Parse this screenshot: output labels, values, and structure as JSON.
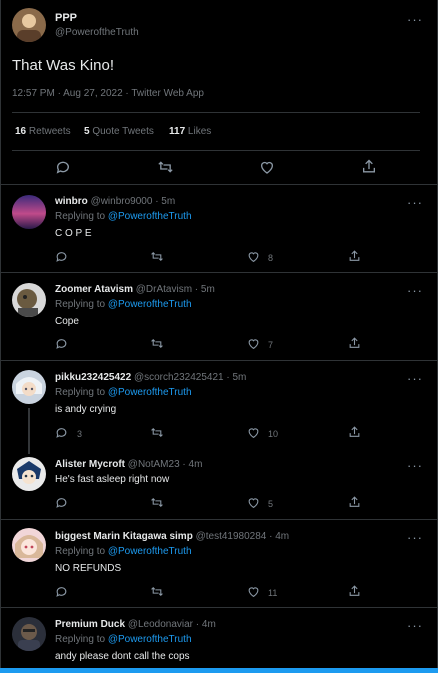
{
  "main": {
    "author_name": "PPP",
    "author_handle": "@PoweroftheTruth",
    "text": "That Was Kino!",
    "meta": "12:57 PM · Aug 27, 2022 · Twitter Web App",
    "stats": {
      "retweets_count": "16",
      "retweets_label": "Retweets",
      "quotes_count": "5",
      "quotes_label": "Quote Tweets",
      "likes_count": "117",
      "likes_label": "Likes"
    }
  },
  "more_glyph": "···",
  "replies": [
    {
      "name": "winbro",
      "handle_time": "@winbro9000 · 5m",
      "replying_prefix": "Replying to",
      "replying_to": "@PoweroftheTruth",
      "text": "C O P E",
      "reply_count": "",
      "like_count": "8"
    },
    {
      "name": "Zoomer Atavism",
      "handle_time": "@DrAtavism · 5m",
      "replying_prefix": "Replying to",
      "replying_to": "@PoweroftheTruth",
      "text": "Cope",
      "reply_count": "",
      "like_count": "7"
    },
    {
      "name": "pikku232425422",
      "handle_time": "@scorch232425421 · 5m",
      "replying_prefix": "Replying to",
      "replying_to": "@PoweroftheTruth",
      "text": "is andy crying",
      "reply_count": "3",
      "like_count": "10"
    },
    {
      "name": "Alister Mycroft",
      "handle_time": "@NotAM23 · 4m",
      "replying_prefix": "",
      "replying_to": "",
      "text": "He's fast asleep right now",
      "reply_count": "",
      "like_count": "5"
    },
    {
      "name": "biggest Marin Kitagawa simp",
      "handle_time": "@test41980284 · 4m",
      "replying_prefix": "Replying to",
      "replying_to": "@PoweroftheTruth",
      "text": "NO REFUNDS",
      "reply_count": "",
      "like_count": "11"
    },
    {
      "name": "Premium Duck",
      "handle_time": "@Leodonaviar · 4m",
      "replying_prefix": "Replying to",
      "replying_to": "@PoweroftheTruth",
      "text": "andy please dont call the cops",
      "reply_count": "",
      "like_count": ""
    }
  ],
  "colors": {
    "background": "#000000",
    "accent": "#1d9bf0",
    "muted": "#71767b",
    "divider": "#2f3336"
  }
}
